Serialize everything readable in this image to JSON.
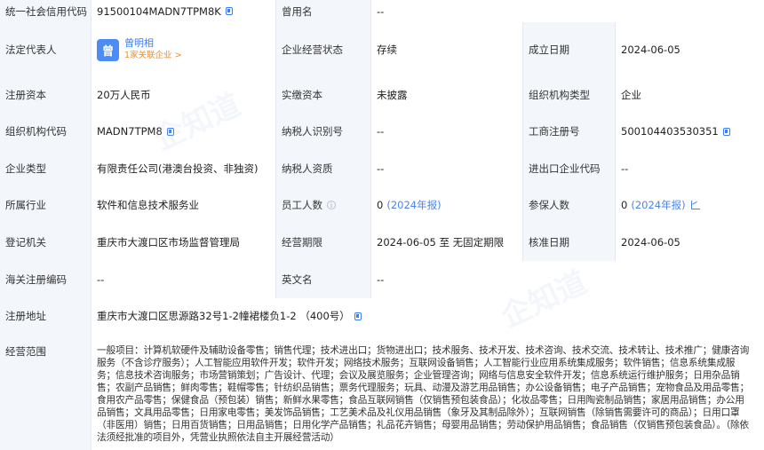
{
  "uscc": {
    "label": "统一社会信用代码",
    "value": "91500104MADN7TPM8K"
  },
  "former_name": {
    "label": "曾用名",
    "value": "--"
  },
  "legal_rep": {
    "label": "法定代表人",
    "avatar_char": "曾",
    "name": "曾明相",
    "related": "1家关联企业 >"
  },
  "business_status": {
    "label": "企业经营状态",
    "value": "存续"
  },
  "established": {
    "label": "成立日期",
    "value": "2024-06-05"
  },
  "registered_capital": {
    "label": "注册资本",
    "value": "20万人民币"
  },
  "paid_capital": {
    "label": "实缴资本",
    "value": "未披露"
  },
  "org_type": {
    "label": "组织机构类型",
    "value": "企业"
  },
  "org_code": {
    "label": "组织机构代码",
    "value": "MADN7TPM8"
  },
  "taxpayer_id": {
    "label": "纳税人识别号",
    "value": "--"
  },
  "biz_reg_no": {
    "label": "工商注册号",
    "value": "500104403530351"
  },
  "company_type": {
    "label": "企业类型",
    "value": "有限责任公司(港澳台投资、非独资)"
  },
  "taxpayer_qual": {
    "label": "纳税人资质",
    "value": "--"
  },
  "import_export": {
    "label": "进出口企业代码",
    "value": "--"
  },
  "industry": {
    "label": "所属行业",
    "value": "软件和信息技术服务业"
  },
  "employees": {
    "label": "员工人数",
    "value": "0",
    "note": "(2024年报)"
  },
  "insured": {
    "label": "参保人数",
    "value": "0",
    "note": "(2024年报)"
  },
  "authority": {
    "label": "登记机关",
    "value": "重庆市大渡口区市场监督管理局"
  },
  "period": {
    "label": "经营期限",
    "value": "2024-06-05 至 无固定期限"
  },
  "approval_date": {
    "label": "核准日期",
    "value": "2024-06-05"
  },
  "customs_code": {
    "label": "海关注册编码",
    "value": "--"
  },
  "english_name": {
    "label": "英文名",
    "value": "--"
  },
  "address": {
    "label": "注册地址",
    "value": "重庆市大渡口区思源路32号1-2幢裙楼负1-2 （400号）"
  },
  "scope": {
    "label": "经营范围",
    "value": "一般项目：计算机软硬件及辅助设备零售；销售代理；技术进出口；货物进出口；技术服务、技术开发、技术咨询、技术交流、技术转让、技术推广；健康咨询服务（不含诊疗服务）；人工智能应用软件开发；软件开发；网络技术服务；互联网设备销售；人工智能行业应用系统集成服务；软件销售；信息系统集成服务；信息技术咨询服务；市场营销策划；广告设计、代理；会议及展览服务；企业管理咨询；网络与信息安全软件开发；信息系统运行维护服务；日用杂品销售；农副产品销售；鲜肉零售；鞋帽零售；针纺织品销售；票务代理服务；玩具、动漫及游艺用品销售；办公设备销售；电子产品销售；宠物食品及用品零售；食用农产品零售；保健食品（预包装）销售；新鲜水果零售；食品互联网销售（仅销售预包装食品）；化妆品零售；日用陶瓷制品销售；家居用品销售；办公用品销售；文具用品零售；日用家电零售；美发饰品销售；工艺美术品及礼仪用品销售（象牙及其制品除外）；互联网销售（除销售需要许可的商品）；日用口罩（非医用）销售；日用百货销售；日用品销售；日用化学产品销售；礼品花卉销售；母婴用品销售；劳动保护用品销售；食品销售（仅销售预包装食品）。（除依法须经批准的项目外，凭营业执照依法自主开展经营活动）"
  },
  "watermark": "企知道",
  "colors": {
    "label_bg": "#f3f6fb",
    "border": "#e4e8f0",
    "link": "#3b7cf5",
    "related": "#f28c28",
    "avatar": "#4b8cf7"
  }
}
